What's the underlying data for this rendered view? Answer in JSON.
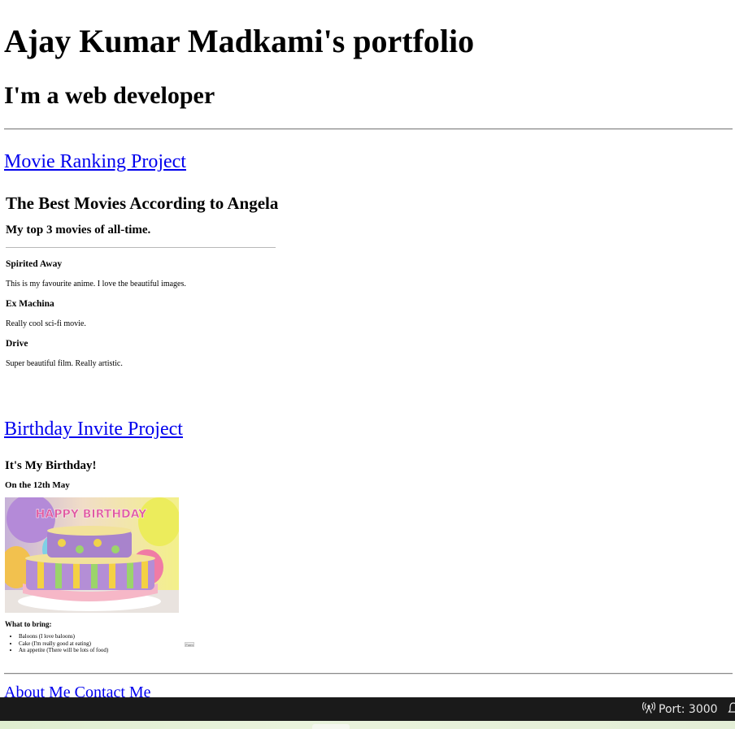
{
  "header": {
    "title": "Ajay Kumar Madkami's portfolio",
    "subtitle": "I'm a web developer"
  },
  "projects": [
    {
      "link_label": "Movie Ranking Project",
      "preview": {
        "title": "The Best Movies According to Angela",
        "subtitle": "My top 3 movies of all-time.",
        "movies": [
          {
            "name": "Spirited Away",
            "description": "This is my favourite anime. I love the beautiful images."
          },
          {
            "name": "Ex Machina",
            "description": "Really cool sci-fi movie."
          },
          {
            "name": "Drive",
            "description": "Super beautiful film. Really artistic."
          }
        ]
      }
    },
    {
      "link_label": "Birthday Invite Project",
      "preview": {
        "title": "It's My Birthday!",
        "date": "On the 12th May",
        "image_text": "HAPPY BIRTHDAY",
        "bring_heading": "What to bring:",
        "items": [
          "Baloons (I love baloons)",
          "Cake (I'm really good at eating)",
          "An appetite (There will be lots of food)"
        ],
        "button_label": "Form"
      }
    }
  ],
  "footer": {
    "about_label": "About Me",
    "contact_label": "Contact Me"
  },
  "statusbar": {
    "port_label": "Port: 3000",
    "port_icon": "broadcast-icon",
    "bell_icon": "bell-icon"
  }
}
